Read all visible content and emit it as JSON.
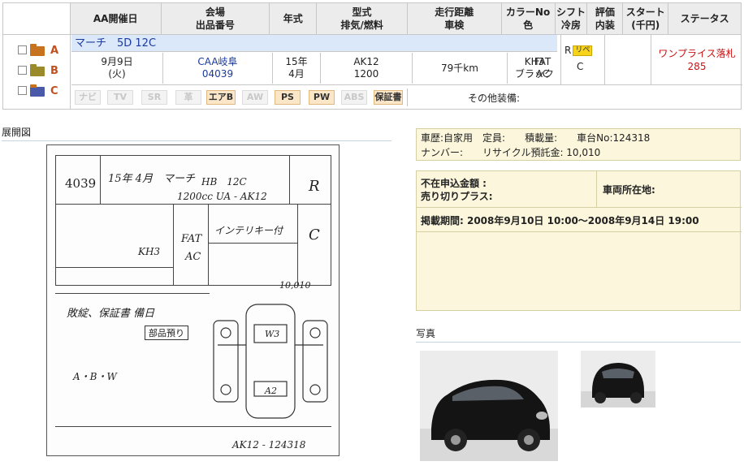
{
  "header": {
    "c1": "AA開催日",
    "c2a": "会場",
    "c2b": "出品番号",
    "c3": "年式",
    "c4a": "型式",
    "c4b": "排気/燃料",
    "c5a": "走行距離",
    "c5b": "車検",
    "c6a": "カラーNo",
    "c6b": "色",
    "c7a": "シフト",
    "c7b": "冷房",
    "c8a": "評価",
    "c8b": "内装",
    "c9a": "スタート",
    "c9b": "(千円)",
    "c10": "ステータス"
  },
  "row": {
    "title": "マーチ　5D 12C",
    "letters": [
      "A",
      "B",
      "C"
    ],
    "date": "9月9日",
    "weekday": "(火)",
    "venue": "CAA岐阜",
    "lot": "04039",
    "year": "15年",
    "month": "4月",
    "model": "AK12",
    "cc": "1200",
    "mileage": "79千km",
    "color_no": "KH3",
    "color": "ブラック",
    "shift": "FAT",
    "ac": "AC",
    "grade": "R",
    "badge": "リペ",
    "interior": "C",
    "status": "ワンプライス落札",
    "price": "285"
  },
  "options": [
    {
      "label": "ナビ",
      "on": false
    },
    {
      "label": "TV",
      "on": false
    },
    {
      "label": "SR",
      "on": false
    },
    {
      "label": "革",
      "on": false
    },
    {
      "label": "エアB",
      "on": true
    },
    {
      "label": "AW",
      "on": false
    },
    {
      "label": "PS",
      "on": true
    },
    {
      "label": "PW",
      "on": true
    },
    {
      "label": "ABS",
      "on": false
    },
    {
      "label": "保証書",
      "on": true
    }
  ],
  "other_equipment": "その他装備:",
  "sections": {
    "sheet_title": "展開図",
    "photo_title": "写真"
  },
  "info": {
    "line1": "車歴:自家用　定員:　　積載量:　　車台No:124318",
    "line2": "ナンバー:　　リサイクル預託金: 10,010",
    "absent_bid": "不在申込金額 :",
    "sell_plus": "売り切りプラス:",
    "location": "車両所在地:",
    "period": "掲載期間: 2008年9月10日 10:00〜2008年9月14日 19:00"
  },
  "sheet": {
    "lot": "4039",
    "t1": "15年 4月　マーチ",
    "t2": "HB　12C",
    "t3": "1200cc UA - AK12",
    "t4": "R",
    "t5": "インテリキー付",
    "t6": "FAT",
    "t7": "AC",
    "t8": "KH3",
    "t9": "C",
    "t10": "敗綻、保証書 備日",
    "t11": "部品預り",
    "t12": "A・B・W",
    "t13": "10,010",
    "t14": "AK12 - 124318",
    "t15": "W3",
    "t16": "A2"
  },
  "colors": {
    "header_bg": "#ececec",
    "title_bg": "#dbe8fa",
    "info_bg": "#fbf6dc",
    "status_red": "#cc1111",
    "link_blue": "#1a3a9c"
  }
}
